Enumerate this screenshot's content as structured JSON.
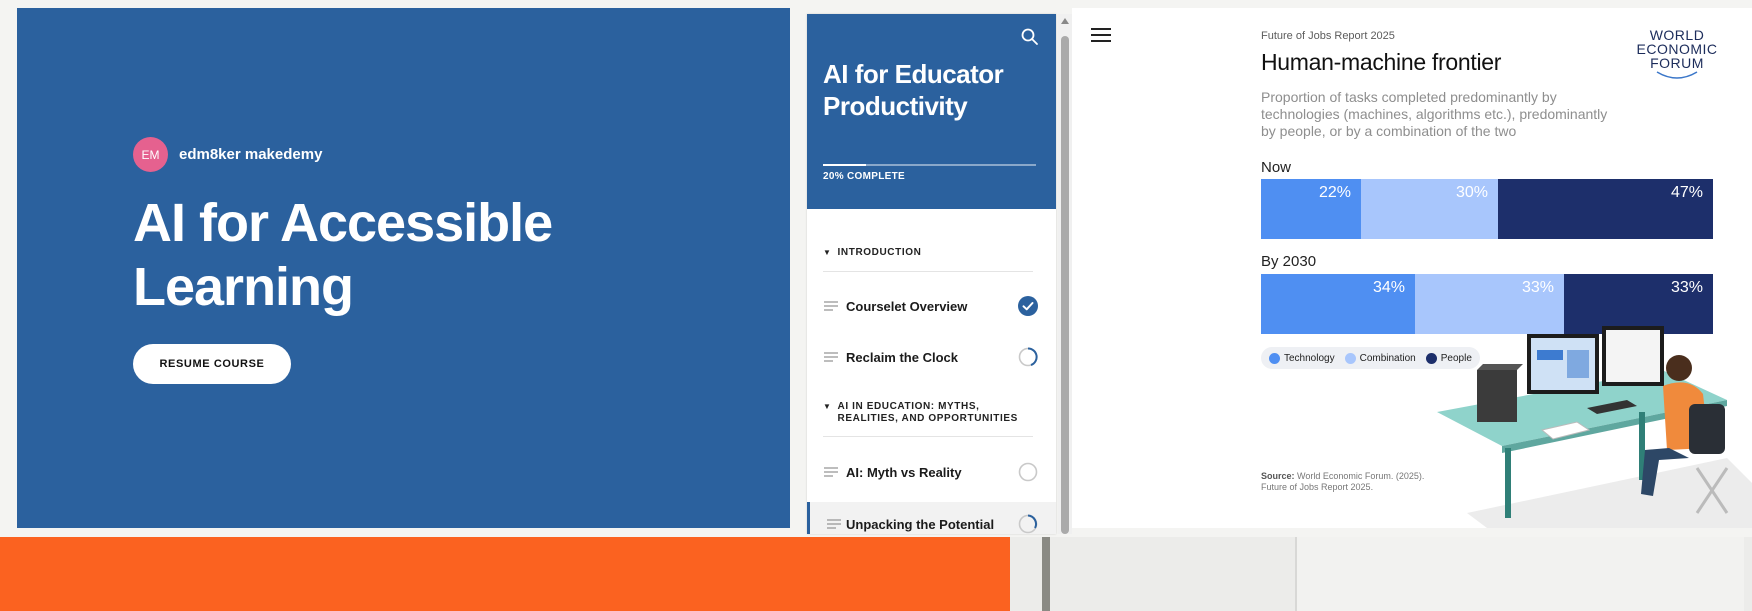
{
  "hero": {
    "author_initials": "EM",
    "author_name": "edm8ker makedemy",
    "title": "AI for Accessible Learning",
    "resume_label": "RESUME COURSE"
  },
  "sidebar": {
    "course_title": "AI for Educator Productivity",
    "progress_percent": 20,
    "progress_label": "20% COMPLETE",
    "sections": [
      {
        "title": "INTRODUCTION",
        "lessons": [
          {
            "label": "Courselet Overview",
            "status": "complete"
          },
          {
            "label": "Reclaim the Clock",
            "status": "in-progress"
          }
        ]
      },
      {
        "title": "AI IN EDUCATION: MYTHS, REALITIES, AND OPPORTUNITIES",
        "lessons": [
          {
            "label": "AI: Myth vs Reality",
            "status": "not-started"
          },
          {
            "label": "Unpacking the Potential",
            "status": "in-progress"
          }
        ]
      }
    ]
  },
  "infographic": {
    "kicker": "Future of Jobs Report 2025",
    "title": "Human-machine frontier",
    "subtitle": "Proportion of tasks completed predominantly by technologies (machines, algorithms etc.), predominantly by people, or by a combination of the two",
    "logo_text": "WORLD ECONOMIC FORUM",
    "source_label": "Source:",
    "source_text": "World Economic Forum. (2025). Future of Jobs Report 2025.",
    "legend": [
      "Technology",
      "Combination",
      "People"
    ]
  },
  "chart_data": {
    "type": "bar",
    "stacked": true,
    "orientation": "horizontal",
    "categories": [
      "Now",
      "By 2030"
    ],
    "series": [
      {
        "name": "Technology",
        "values": [
          22,
          34
        ],
        "labels": [
          "22%",
          "34%"
        ]
      },
      {
        "name": "Combination",
        "values": [
          30,
          33
        ],
        "labels": [
          "30%",
          "33%"
        ]
      },
      {
        "name": "People",
        "values": [
          47,
          33
        ],
        "labels": [
          "47%",
          "33%"
        ]
      }
    ],
    "colors": {
      "Technology": "#4f8ff2",
      "Combination": "#a8c6fc",
      "People": "#1d2f6b"
    },
    "legend_position": "bottom-left"
  },
  "colors": {
    "hero_blue": "#2b619e",
    "avatar_pink": "#e5618f",
    "orange_band": "#fb6220",
    "check_blue": "#2b619e"
  },
  "icons": {
    "search": "search-icon",
    "menu": "hamburger-menu-icon",
    "check": "check-circle-icon",
    "lesson": "lesson-lines-icon"
  }
}
